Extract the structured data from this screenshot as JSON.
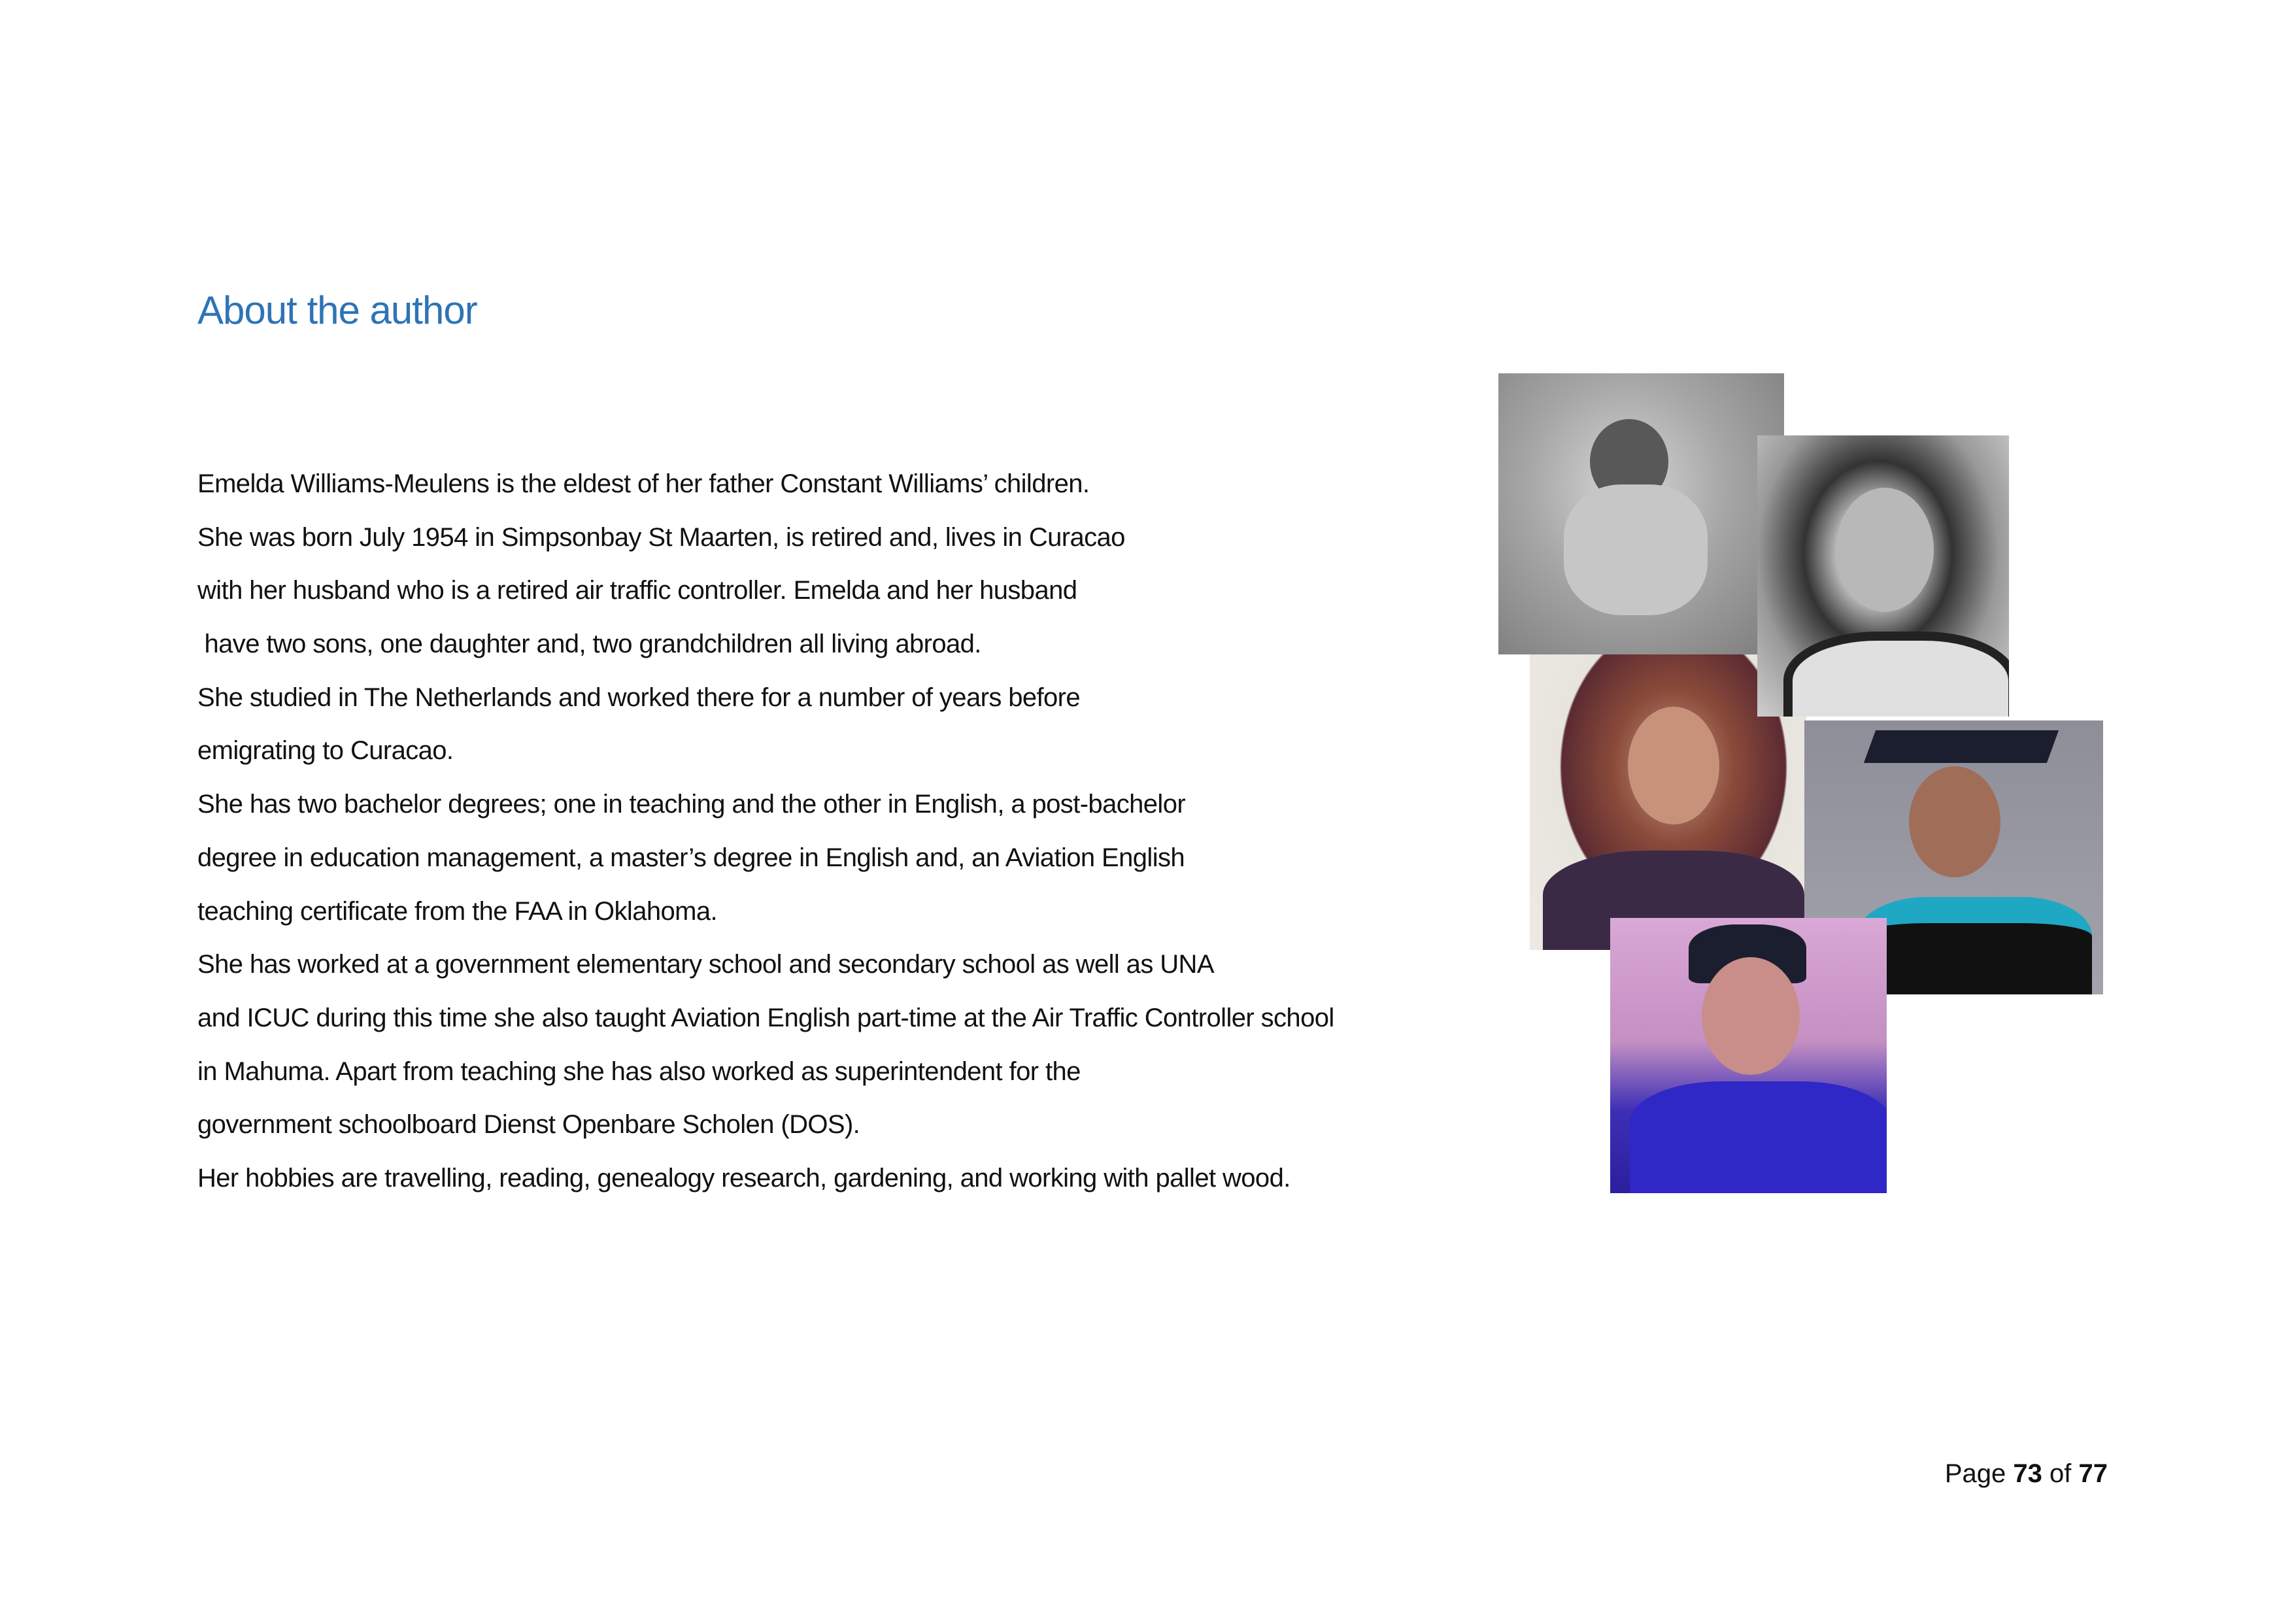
{
  "heading": "About the author",
  "paragraph_lines": [
    "Emelda Williams-Meulens is the eldest of her father Constant Williams’ children.",
    "She was born July 1954 in Simpsonbay St Maarten, is retired and, lives in Curacao",
    "with her husband who is a retired air traffic controller. Emelda and her husband",
    " have two sons, one daughter and, two grandchildren all living abroad.",
    "She studied in The Netherlands and worked there for a number of years before",
    "emigrating to Curacao.",
    "She has two bachelor degrees; one in teaching and the other in English, a post-bachelor",
    "degree in education management, a master’s degree in English and, an Aviation English",
    "teaching certificate from the FAA in Oklahoma.",
    "She has worked at a government elementary school and secondary school as well as UNA",
    "and ICUC during this time she also taught Aviation English part-time at the Air Traffic Controller school",
    "in Mahuma. Apart from teaching she has also worked as superintendent for the",
    "government schoolboard Dienst Openbare Scholen (DOS).",
    "Her hobbies are travelling, reading, genealogy research, gardening, and working with pallet wood."
  ],
  "footer": {
    "page_prefix": "Page",
    "current_page": "73",
    "page_separator": "of",
    "total_pages": "77"
  },
  "colors": {
    "heading": "#2e74b5",
    "text": "#111111"
  }
}
